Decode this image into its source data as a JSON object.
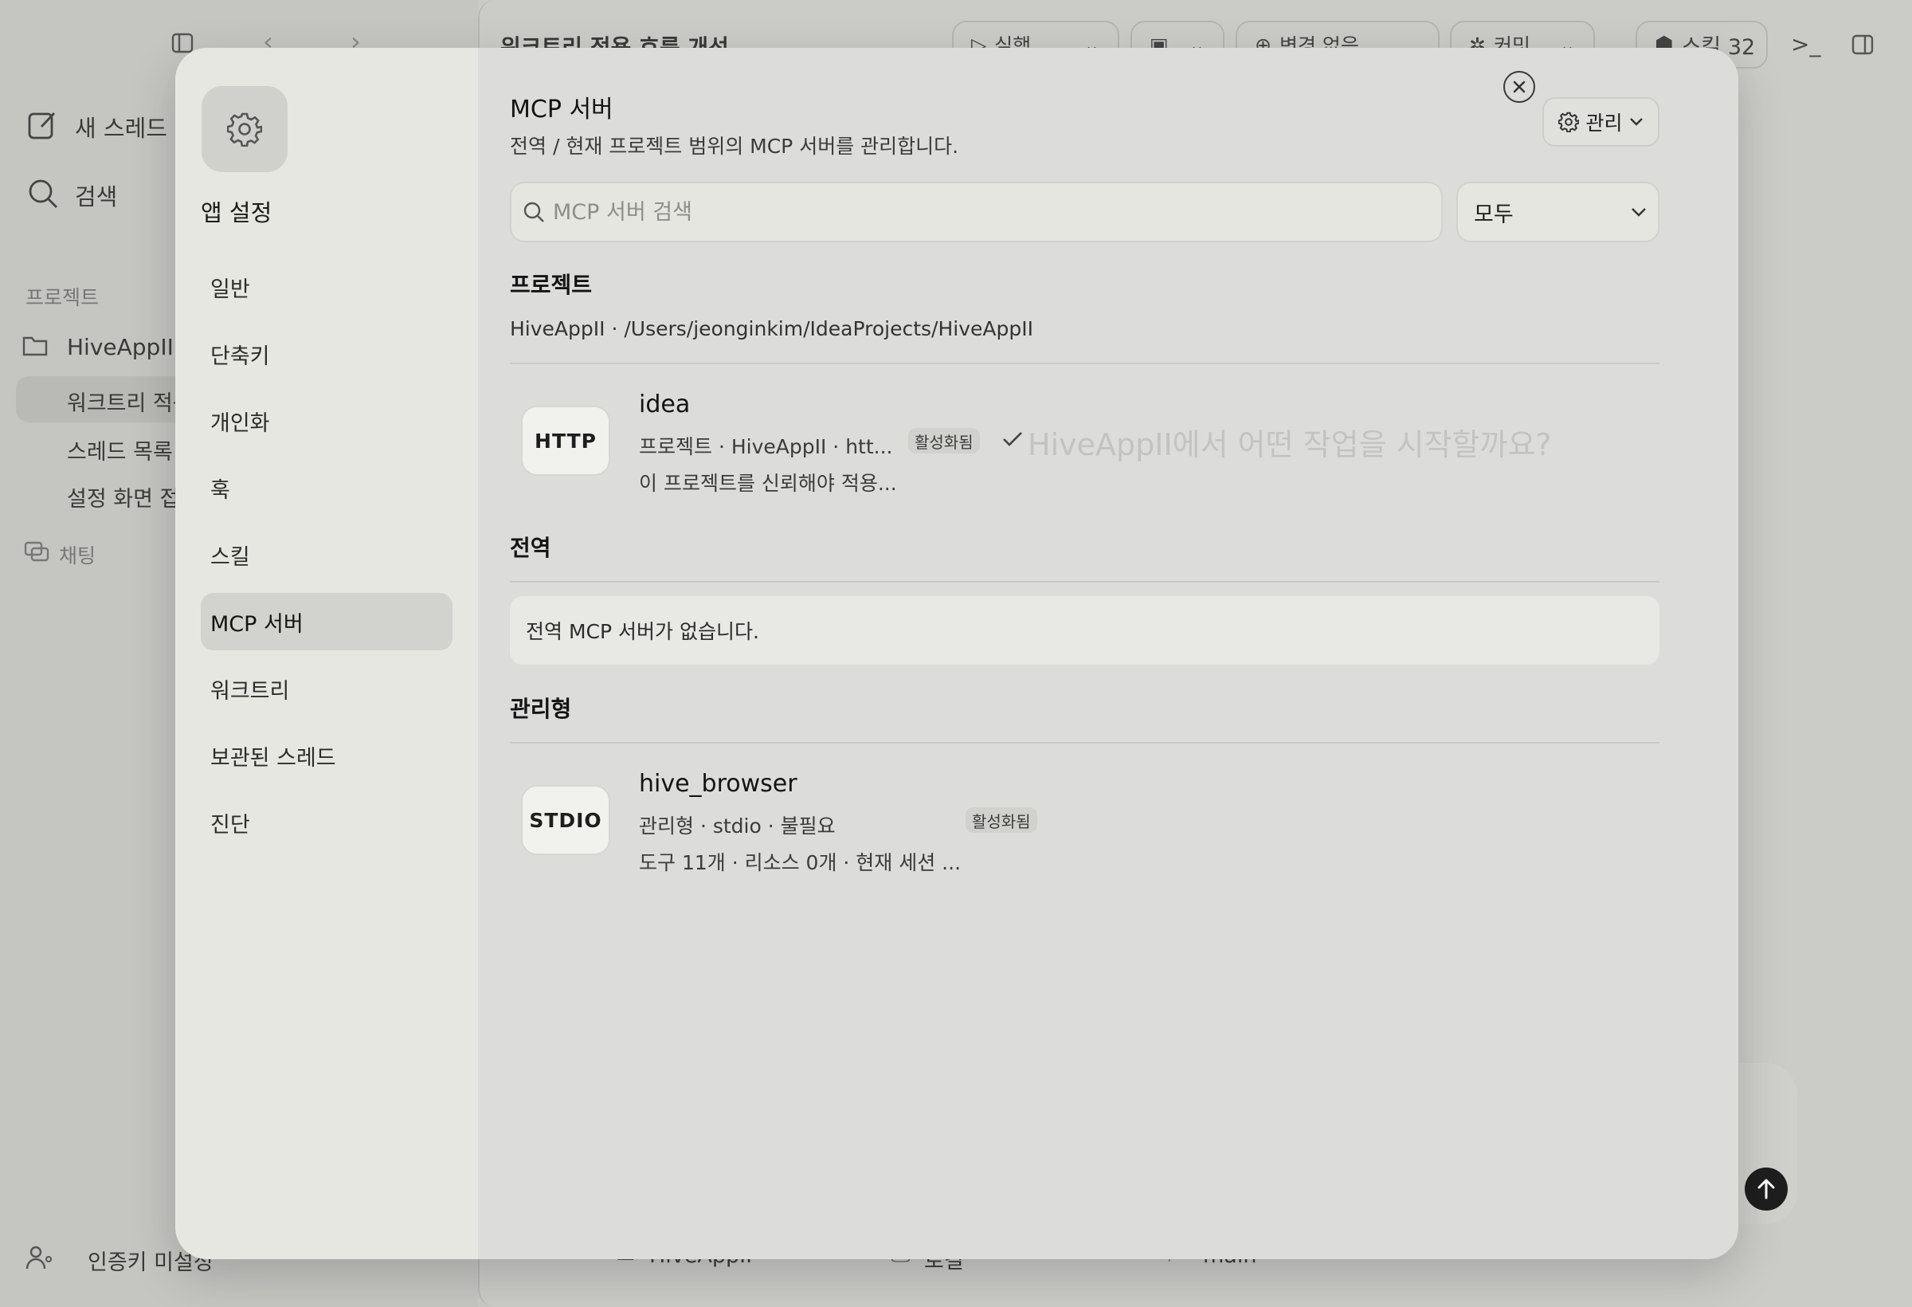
{
  "background": {
    "sidebar": {
      "new_thread": "새 스레드",
      "search": "검색",
      "projects_label": "프로젝트",
      "project_name": "HiveAppII",
      "threads": [
        "워크트리 적용 흐름 개선",
        "스레드 목록",
        "설정 화면 접"
      ],
      "chat_label": "채팅",
      "auth_status": "인증키 미설정"
    },
    "header": {
      "title": "워크트리 적용 흐름 개선",
      "run_label": "실행",
      "changes_label": "변경 없음",
      "commit_label": "커밋",
      "skills_label": "스킬 32"
    },
    "composer": {
      "ghost_prompt": "HiveAppII에서 어떤 작업을 시작할까요?"
    },
    "footer": {
      "project": "HiveAppII",
      "env": "로컬",
      "branch": "main"
    }
  },
  "settings": {
    "sidebar_title": "앱 설정",
    "nav": [
      "일반",
      "단축키",
      "개인화",
      "훅",
      "스킬",
      "MCP 서버",
      "워크트리",
      "보관된 스레드",
      "진단"
    ],
    "active_nav": "MCP 서버",
    "page_title": "MCP 서버",
    "page_description": "전역 / 현재 프로젝트 범위의 MCP 서버를 관리합니다.",
    "manage_button": "관리",
    "search_placeholder": "MCP 서버 검색",
    "filter_value": "모두",
    "sections": {
      "project": {
        "title": "프로젝트",
        "subtitle": "HiveAppII · /Users/jeonginkim/IdeaProjects/HiveAppII",
        "server": {
          "badge": "HTTP",
          "name": "idea",
          "meta": "프로젝트 · HiveAppII · htt...",
          "status": "활성화됨",
          "description": "이 프로젝트를 신뢰해야 적용..."
        }
      },
      "global": {
        "title": "전역",
        "empty": "전역 MCP 서버가 없습니다."
      },
      "managed": {
        "title": "관리형",
        "server": {
          "badge": "STDIO",
          "name": "hive_browser",
          "meta": "관리형 · stdio · 불필요",
          "status": "활성화됨",
          "description": "도구 11개 · 리소스 0개 · 현재 세션 ..."
        }
      }
    }
  }
}
